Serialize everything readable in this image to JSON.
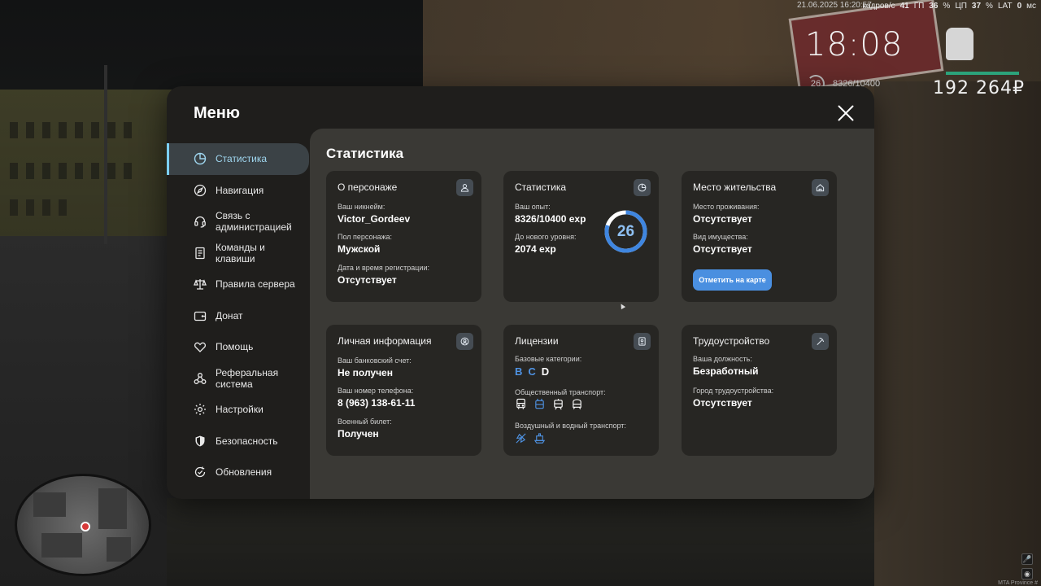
{
  "hud": {
    "date": "21.06.2025 16:20:57",
    "fps_label": "кадров/с",
    "fps": "41",
    "gpu_label": "ГП",
    "gpu": "36",
    "cpu_label": "ЦП",
    "cpu": "37",
    "percent": "%",
    "lat_label": "LAT",
    "lat": "0",
    "ms": "мс",
    "time": "18:08",
    "level": "26",
    "exp": "8326/10400",
    "money": "192 264₽",
    "watermark": "MTA Province #"
  },
  "menu": {
    "title": "Меню",
    "sidebar": [
      {
        "label": "Статистика",
        "icon": "pie-chart-icon",
        "active": true
      },
      {
        "label": "Навигация",
        "icon": "compass-icon"
      },
      {
        "label": "Связь с администрацией",
        "icon": "headset-icon"
      },
      {
        "label": "Команды и клавиши",
        "icon": "document-icon"
      },
      {
        "label": "Правила сервера",
        "icon": "scales-icon"
      },
      {
        "label": "Донат",
        "icon": "wallet-icon"
      },
      {
        "label": "Помощь",
        "icon": "heart-hands-icon"
      },
      {
        "label": "Реферальная система",
        "icon": "referral-icon"
      },
      {
        "label": "Настройки",
        "icon": "gear-icon"
      },
      {
        "label": "Безопасность",
        "icon": "shield-icon"
      },
      {
        "label": "Обновления",
        "icon": "refresh-check-icon"
      }
    ]
  },
  "content": {
    "title": "Статистика",
    "character": {
      "title": "О персонаже",
      "icon": "user-icon",
      "nick_label": "Ваш никнейм:",
      "nick": "Victor_Gordeev",
      "gender_label": "Пол персонажа:",
      "gender": "Мужской",
      "reg_label": "Дата и время регистрации:",
      "reg": "Отсутствует"
    },
    "stats": {
      "title": "Статистика",
      "icon": "clock-pie-icon",
      "exp_label": "Ваш опыт:",
      "exp": "8326/10400 exp",
      "next_label": "До нового уровня:",
      "next": "2074 exp",
      "level": "26",
      "progress": 0.8006
    },
    "residence": {
      "title": "Место жительства",
      "icon": "house-icon",
      "place_label": "Место проживания:",
      "place": "Отсутствует",
      "property_label": "Вид имущества:",
      "property": "Отсутствует",
      "button": "Отметить на карте"
    },
    "personal": {
      "title": "Личная информация",
      "icon": "user-circle-icon",
      "bank_label": "Ваш банковский счет:",
      "bank": "Не получен",
      "phone_label": "Ваш номер телефона:",
      "phone": "8 (963) 138-61-11",
      "military_label": "Военный билет:",
      "military": "Получен"
    },
    "licenses": {
      "title": "Лицензии",
      "icon": "id-card-icon",
      "base_label": "Базовые категории:",
      "categories": [
        {
          "name": "B",
          "owned": true
        },
        {
          "name": "C",
          "owned": true
        },
        {
          "name": "D",
          "owned": false
        }
      ],
      "public_label": "Общественный транспорт:",
      "air_label": "Воздушный и водный транспорт:"
    },
    "employment": {
      "title": "Трудоустройство",
      "icon": "pickaxe-icon",
      "position_label": "Ваша должность:",
      "position": "Безработный",
      "city_label": "Город трудоустройства:",
      "city": "Отсутствует"
    }
  },
  "colors": {
    "accent_blue": "#4a8fe0",
    "active_text": "#9fd6ef",
    "card_bg": "#272623",
    "panel_bg": "#3a3935"
  }
}
